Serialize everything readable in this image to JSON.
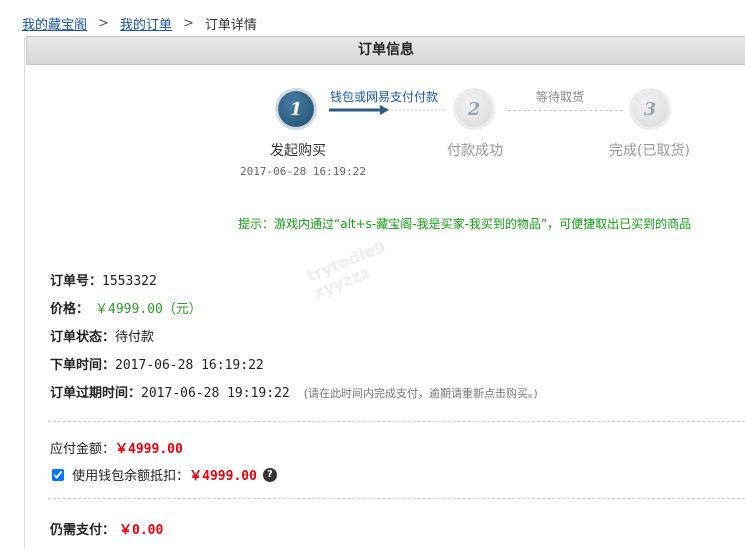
{
  "breadcrumb": {
    "item1": "我的藏宝阁",
    "item2": "我的订单",
    "current": "订单详情",
    "separator": ">"
  },
  "panel": {
    "title": "订单信息"
  },
  "steps": [
    {
      "number": "1",
      "label": "发起购买",
      "time": "2017-06-28 16:19:22",
      "state": "active"
    },
    {
      "number": "2",
      "label": "付款成功",
      "state": "todo"
    },
    {
      "number": "3",
      "label": "完成(已取货)",
      "state": "todo"
    }
  ],
  "step_links": {
    "first": "钱包或网易支付付款",
    "second": "等待取货"
  },
  "hint": "提示：游戏内通过“alt+s-藏宝阁-我是买家-我买到的物品”，可便捷取出已买到的商品",
  "order": {
    "id_label": "订单号：",
    "id_value": "1553322",
    "price_label": "价格：",
    "price_value": "￥4999.00（元）",
    "status_label": "订单状态：",
    "status_value": "待付款",
    "created_label": "下单时间：",
    "created_value": "2017-06-28 16:19:22",
    "expire_label": "订单过期时间：",
    "expire_value": "2017-06-28 19:19:22",
    "expire_note": "(请在此时间内完成支付，逾期请重新点击购买。)"
  },
  "payment": {
    "due_label": "应付金额：",
    "due_value": "￥4999.00",
    "wallet_label": "使用钱包余额抵扣：",
    "wallet_value": "￥4999.00",
    "wallet_checked": true,
    "help_symbol": "?",
    "remaining_label": "仍需支付：",
    "remaining_value": "￥0.00"
  },
  "colors": {
    "link_blue": "#1a56a8",
    "hint_green": "#12a012",
    "price_green": "#2e9a2e",
    "amount_red": "#e8000b",
    "step_active": "#2a5c80"
  }
}
